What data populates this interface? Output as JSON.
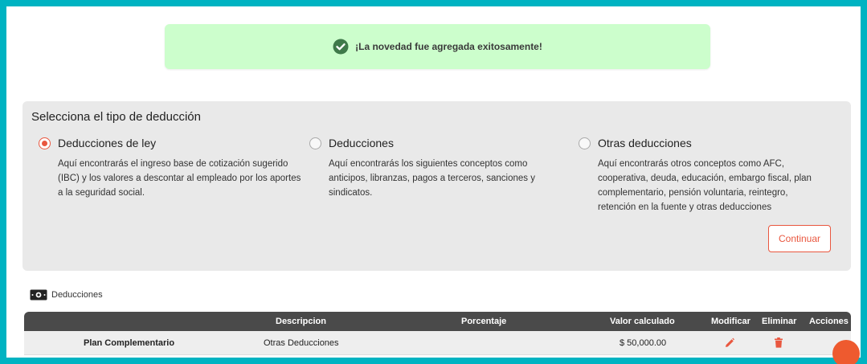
{
  "alert": {
    "message": "¡La novedad fue agregada exitosamente!"
  },
  "deduction_type": {
    "title": "Selecciona el tipo de deducción",
    "options": [
      {
        "label": "Deducciones de ley",
        "description": "Aquí encontrarás el ingreso base de cotización sugerido (IBC) y los valores a descontar al empleado por los aportes a la seguridad social.",
        "selected": true
      },
      {
        "label": "Deducciones",
        "description": "Aquí encontrarás los siguientes conceptos como anticipos, libranzas, pagos a terceros, sanciones y sindicatos.",
        "selected": false
      },
      {
        "label": "Otras deducciones",
        "description": "Aquí encontrarás otros conceptos como AFC, cooperativa, deuda, educación, embargo fiscal, plan complementario, pensión voluntaria, reintegro, retención en la fuente y otras deducciones",
        "selected": false
      }
    ],
    "continue_label": "Continuar"
  },
  "deductions_table": {
    "section_label": "Deducciones",
    "columns": [
      "",
      "Descripcion",
      "Porcentaje",
      "Valor calculado",
      "Modificar",
      "Eliminar",
      "Acciones"
    ],
    "rows": [
      {
        "name": "Plan Complementario",
        "description": "Otras Deducciones",
        "percentage": "",
        "value": "$ 50,000.00"
      }
    ]
  },
  "colors": {
    "accent": "#e9573f",
    "frame": "#00b3c2",
    "success_bg": "#ccfecc",
    "header_bg": "#4a4a4a"
  }
}
